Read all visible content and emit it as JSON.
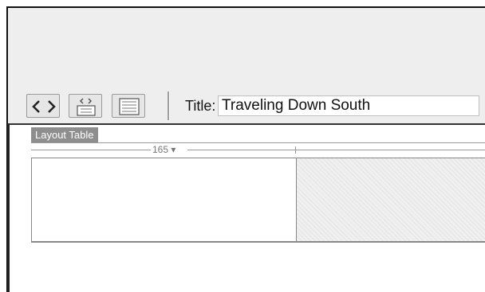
{
  "toolbar": {
    "buttons": [
      {
        "name": "code-view",
        "icon": "code-icon"
      },
      {
        "name": "split-view",
        "icon": "split-view-icon"
      },
      {
        "name": "design-view",
        "icon": "design-view-icon"
      }
    ],
    "title_label": "Title:",
    "title_value": "Traveling Down South"
  },
  "document": {
    "layout_table_label": "Layout Table",
    "column_width": "165 ▾"
  },
  "colors": {
    "window_bg": "#eeeeee",
    "tab_bg": "#8e8e8e",
    "table_border": "#888888"
  }
}
